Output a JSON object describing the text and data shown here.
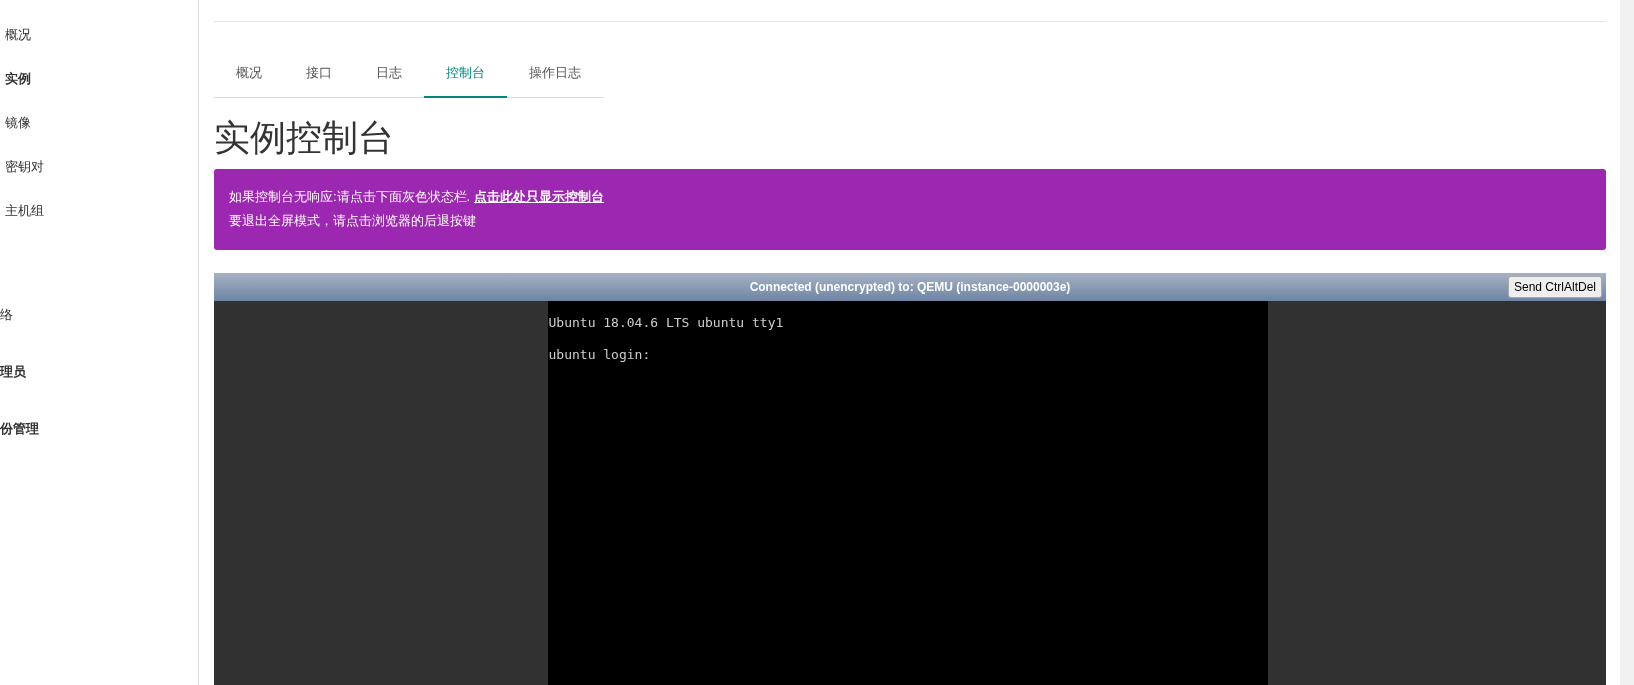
{
  "sidebar": {
    "items": [
      {
        "label": "概况",
        "kind": "sub",
        "selected": false
      },
      {
        "label": "实例",
        "kind": "sub",
        "selected": true
      },
      {
        "label": "镜像",
        "kind": "sub",
        "selected": false
      },
      {
        "label": "密钥对",
        "kind": "sub",
        "selected": false
      },
      {
        "label": "主机组",
        "kind": "sub",
        "selected": false
      },
      {
        "label": "络",
        "kind": "section"
      },
      {
        "label": "理员",
        "kind": "group"
      },
      {
        "label": "份管理",
        "kind": "group"
      }
    ]
  },
  "tabs": [
    {
      "label": "概况",
      "selected": false
    },
    {
      "label": "接口",
      "selected": false
    },
    {
      "label": "日志",
      "selected": false
    },
    {
      "label": "控制台",
      "selected": true
    },
    {
      "label": "操作日志",
      "selected": false
    }
  ],
  "heading": "实例控制台",
  "alert": {
    "text": "如果控制台无响应:请点击下面灰色状态栏.",
    "link": "点击此处只显示控制台",
    "line2": "要退出全屏模式，请点击浏览器的后退按键"
  },
  "console": {
    "status": "Connected (unencrypted) to: QEMU (instance-0000003e)",
    "button": "Send CtrlAltDel",
    "lines": [
      "Ubuntu 18.04.6 LTS ubuntu tty1",
      "ubuntu login:"
    ]
  }
}
